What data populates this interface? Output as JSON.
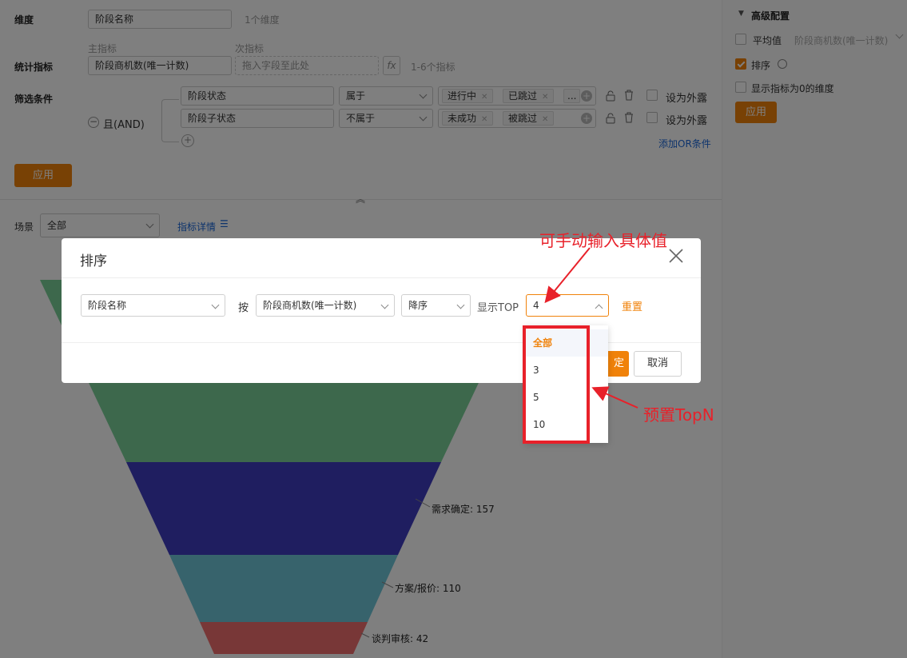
{
  "config": {
    "dimension_label": "维度",
    "dimension_value": "阶段名称",
    "dimension_count": "1个维度",
    "main_metric_label": "主指标",
    "sub_metric_label": "次指标",
    "stat_label": "统计指标",
    "stat_value": "阶段商机数(唯一计数)",
    "sub_placeholder": "拖入字段至此处",
    "fx": "fx",
    "stat_hint": "1-6个指标",
    "filter_label": "筛选条件",
    "logic": "且(AND)",
    "filters": [
      {
        "field": "阶段状态",
        "op": "属于",
        "tags": [
          "进行中",
          "已跳过"
        ],
        "more": "...",
        "expose": "设为外露"
      },
      {
        "field": "阶段子状态",
        "op": "不属于",
        "tags": [
          "未成功",
          "被跳过"
        ],
        "expose": "设为外露"
      }
    ],
    "add_or": "添加OR条件",
    "apply": "应用"
  },
  "advanced": {
    "title": "高级配置",
    "avg_label": "平均值",
    "avg_value": "阶段商机数(唯一计数)",
    "sort_label": "排序",
    "show_zero": "显示指标为0的维度",
    "apply": "应用"
  },
  "scene": {
    "label": "场景",
    "value": "全部",
    "detail_link": "指标详情"
  },
  "funnel": {
    "labels": [
      "需求确定: 157",
      "方案/报价: 110",
      "谈判审核: 42"
    ],
    "colors": {
      "stage1": "#7bd098",
      "stage2": "#3f3dc0",
      "stage3": "#6fc6d9",
      "stage4": "#f06f6f"
    }
  },
  "modal": {
    "title": "排序",
    "dimension": "阶段名称",
    "by": "按",
    "metric": "阶段商机数(唯一计数)",
    "order": "降序",
    "top_label": "显示TOP",
    "top_value": "4",
    "reset": "重置",
    "ok_partial": "定",
    "cancel": "取消"
  },
  "dropdown": {
    "options": [
      "全部",
      "3",
      "5",
      "10"
    ]
  },
  "annotations": {
    "manual_input": "可手动输入具体值",
    "preset_topn": "预置TopN"
  },
  "accent_color": "#f0820a"
}
